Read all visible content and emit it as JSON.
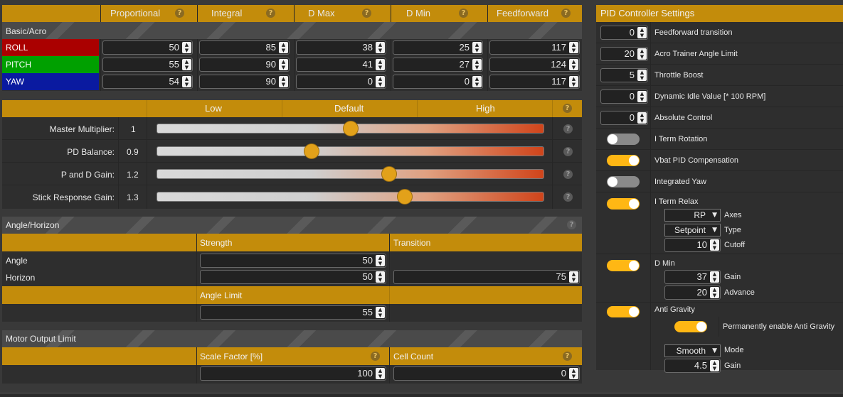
{
  "pid_table": {
    "headers": [
      "Proportional",
      "Integral",
      "D Max",
      "D Min",
      "Feedforward"
    ],
    "section_label": "Basic/Acro",
    "rows": [
      {
        "name": "ROLL",
        "color": "#aa0000",
        "values": [
          "50",
          "85",
          "38",
          "25",
          "117"
        ]
      },
      {
        "name": "PITCH",
        "color": "#00a000",
        "values": [
          "55",
          "90",
          "41",
          "27",
          "124"
        ]
      },
      {
        "name": "YAW",
        "color": "#0a1aa0",
        "values": [
          "54",
          "90",
          "0",
          "0",
          "117"
        ]
      }
    ]
  },
  "sliders": {
    "headers": {
      "low": "Low",
      "default": "Default",
      "high": "High"
    },
    "rows": [
      {
        "label": "Master Multiplier:",
        "value": "1",
        "level": 0.5
      },
      {
        "label": "PD Balance:",
        "value": "0.9",
        "level": 0.4
      },
      {
        "label": "P and D Gain:",
        "value": "1.2",
        "level": 0.6
      },
      {
        "label": "Stick Response Gain:",
        "value": "1.3",
        "level": 0.64
      }
    ]
  },
  "angle_horizon": {
    "title": "Angle/Horizon",
    "strength_label": "Strength",
    "transition_label": "Transition",
    "angle_label": "Angle",
    "horizon_label": "Horizon",
    "angle_strength": "50",
    "horizon_strength": "50",
    "horizon_transition": "75",
    "angle_limit_label": "Angle Limit",
    "angle_limit": "55"
  },
  "motor_output": {
    "title": "Motor Output Limit",
    "scale_label": "Scale Factor [%]",
    "cell_label": "Cell Count",
    "scale_value": "100",
    "cell_value": "0"
  },
  "settings": {
    "title": "PID Controller Settings",
    "feedforward_transition": {
      "value": "0",
      "label": "Feedforward transition"
    },
    "acro_trainer": {
      "value": "20",
      "label": "Acro Trainer Angle Limit"
    },
    "throttle_boost": {
      "value": "5",
      "label": "Throttle Boost"
    },
    "dynamic_idle": {
      "value": "0",
      "label": "Dynamic Idle Value [* 100 RPM]"
    },
    "absolute_control": {
      "value": "0",
      "label": "Absolute Control"
    },
    "iterm_rotation": {
      "label": "I Term Rotation",
      "on": false
    },
    "vbat_pid": {
      "label": "Vbat PID Compensation",
      "on": true
    },
    "integrated_yaw": {
      "label": "Integrated Yaw",
      "on": false
    },
    "iterm_relax": {
      "label": "I Term Relax",
      "on": true,
      "axes": "RP",
      "axes_label": "Axes",
      "type": "Setpoint",
      "type_label": "Type",
      "cutoff": "10",
      "cutoff_label": "Cutoff"
    },
    "d_min": {
      "label": "D Min",
      "on": true,
      "gain": "37",
      "gain_label": "Gain",
      "advance": "20",
      "advance_label": "Advance"
    },
    "anti_gravity": {
      "label": "Anti Gravity",
      "on": true,
      "perm_label": "Permanently enable Anti Gravity",
      "mode": "Smooth",
      "mode_label": "Mode",
      "gain": "4.5",
      "gain_label": "Gain"
    }
  }
}
